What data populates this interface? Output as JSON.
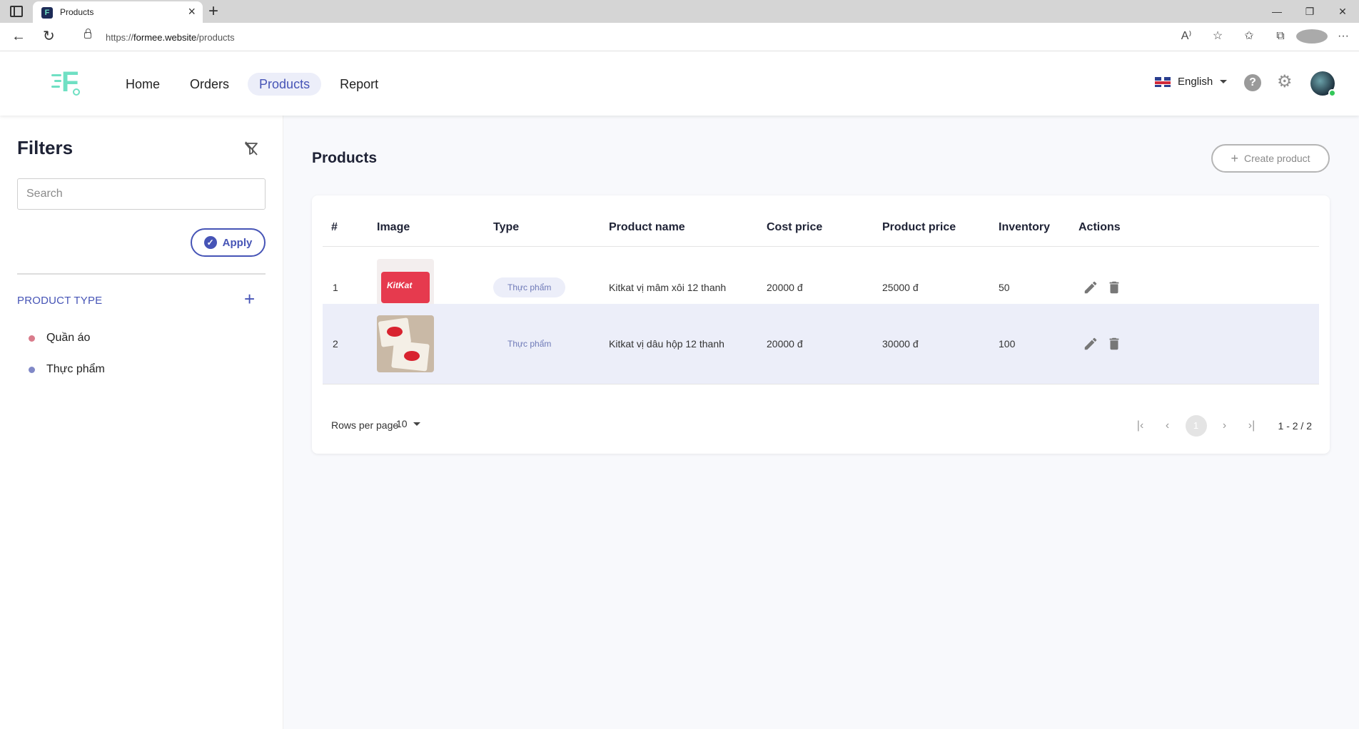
{
  "browser": {
    "tab_title": "Products",
    "tab_favicon": "F",
    "url_prefix": "https://",
    "url_domain": "formee.website",
    "url_path": "/products"
  },
  "header": {
    "nav": [
      "Home",
      "Orders",
      "Products",
      "Report"
    ],
    "active_nav": "Products",
    "language": "English",
    "help_glyph": "?"
  },
  "sidebar": {
    "title": "Filters",
    "search_placeholder": "Search",
    "apply_label": "Apply",
    "product_type_heading": "PRODUCT TYPE",
    "product_types": [
      {
        "label": "Quần áo",
        "color": "#d97b8b"
      },
      {
        "label": "Thực phẩm",
        "color": "#8088c7"
      }
    ]
  },
  "main": {
    "title": "Products",
    "create_label": "Create product",
    "columns": [
      "#",
      "Image",
      "Type",
      "Product name",
      "Cost price",
      "Product price",
      "Inventory",
      "Actions"
    ],
    "rows": [
      {
        "index": "1",
        "type": "Thực phẩm",
        "name": "Kitkat vị mâm xôi 12 thanh",
        "cost": "20000 đ",
        "price": "25000 đ",
        "inventory": "50"
      },
      {
        "index": "2",
        "type": "Thực phẩm",
        "name": "Kitkat vị dâu hộp 12 thanh",
        "cost": "20000 đ",
        "price": "30000 đ",
        "inventory": "100"
      }
    ],
    "rows_per_page_label": "Rows per page",
    "rows_per_page": "10",
    "current_page": "1",
    "range": "1 - 2 / 2"
  },
  "colors": {
    "accent": "#4654b6",
    "active_nav_bg": "#eceef9",
    "brand_logo": "#6fe0c3"
  }
}
